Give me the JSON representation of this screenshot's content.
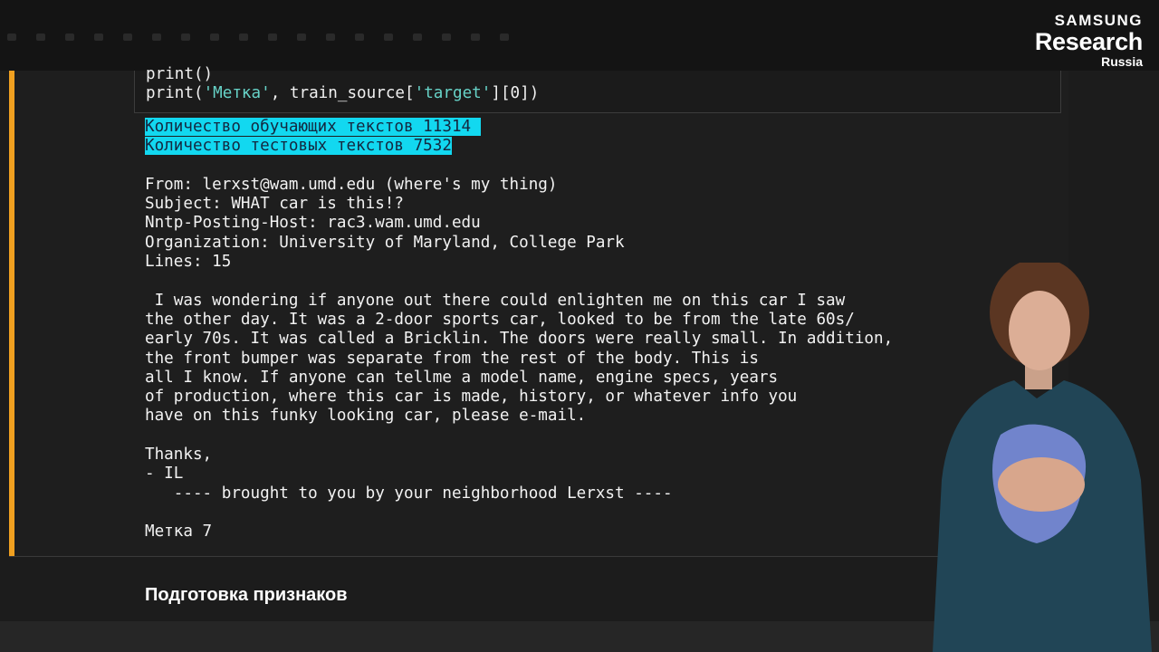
{
  "brand": {
    "line1": "SAMSUNG",
    "line2": "Research",
    "line3": "Russia"
  },
  "input_cell": {
    "line1": "print()",
    "line2_prefix": "print(",
    "line2_str": "'Метка'",
    "line2_mid": ", train_source[",
    "line2_key": "'target'",
    "line2_suffix": "][0])"
  },
  "output": {
    "highlight_line1": "Количество обучающих текстов 11314 ",
    "highlight_line2": "Количество тестовых текстов 7532",
    "lines": [
      "",
      "From: lerxst@wam.umd.edu (where's my thing)",
      "Subject: WHAT car is this!?",
      "Nntp-Posting-Host: rac3.wam.umd.edu",
      "Organization: University of Maryland, College Park",
      "Lines: 15",
      "",
      " I was wondering if anyone out there could enlighten me on this car I saw",
      "the other day. It was a 2-door sports car, looked to be from the late 60s/",
      "early 70s. It was called a Bricklin. The doors were really small. In addition,",
      "the front bumper was separate from the rest of the body. This is",
      "all I know. If anyone can tellme a model name, engine specs, years",
      "of production, where this car is made, history, or whatever info you",
      "have on this funky looking car, please e-mail.",
      "",
      "Thanks,",
      "- IL",
      "   ---- brought to you by your neighborhood Lerxst ----",
      "",
      "Метка 7"
    ]
  },
  "section": {
    "title": "Подготовка признаков"
  }
}
